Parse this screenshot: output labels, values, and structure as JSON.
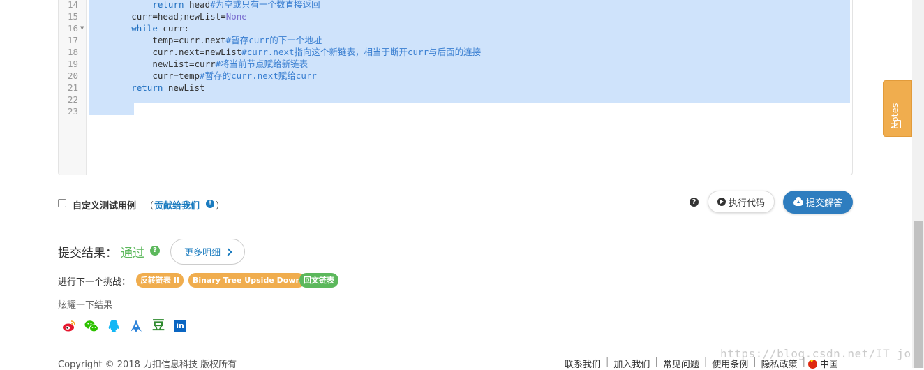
{
  "editor": {
    "lines": [
      {
        "no": "14",
        "fold": false
      },
      {
        "no": "15",
        "fold": false
      },
      {
        "no": "16",
        "fold": true
      },
      {
        "no": "17",
        "fold": false
      },
      {
        "no": "18",
        "fold": false
      },
      {
        "no": "19",
        "fold": false
      },
      {
        "no": "20",
        "fold": false
      },
      {
        "no": "21",
        "fold": false
      },
      {
        "no": "22",
        "fold": false
      },
      {
        "no": "23",
        "fold": false
      }
    ],
    "code": {
      "l14": {
        "indent": "            ",
        "kw": "return",
        "text": " head",
        "comment": "#为空或只有一个数直接返回"
      },
      "l15": {
        "indent": "        ",
        "text": "curr=head;newList=",
        "none": "None"
      },
      "l16": {
        "indent": "        ",
        "kw": "while",
        "text": " curr:"
      },
      "l17": {
        "indent": "            ",
        "text": "temp=curr.next",
        "comment": "#暂存curr的下一个地址"
      },
      "l18": {
        "indent": "            ",
        "text": "curr.next=newList",
        "comment": "#curr.next指向这个新链表，相当于断开curr与后面的连接"
      },
      "l19": {
        "indent": "            ",
        "text": "newList=curr",
        "comment": "#将当前节点赋给新链表"
      },
      "l20": {
        "indent": "            ",
        "text": "curr=temp",
        "comment": "#暂存的curr.next赋给curr"
      },
      "l21": {
        "indent": "        ",
        "kw": "return",
        "text": " newList"
      }
    }
  },
  "custom_test": {
    "label": "自定义测试用例",
    "open_paren": "（",
    "contribute": "贡献给我们",
    "close_paren": "）",
    "checked": false
  },
  "actions": {
    "help": "?",
    "run_label": "执行代码",
    "submit_label": "提交解答"
  },
  "result": {
    "label": "提交结果：",
    "status": "通过",
    "more_label": "更多明细"
  },
  "next_challenge": {
    "label": "进行下一个挑战：",
    "tags": [
      {
        "text": "反转链表 II",
        "color": "#f0ad4e"
      },
      {
        "text": "Binary Tree Upside Down",
        "color": "#f0ad4e"
      },
      {
        "text": "回文链表",
        "color": "#5cb85c"
      }
    ]
  },
  "share": {
    "label": "炫耀一下结果",
    "icons": [
      "weibo-icon",
      "wechat-icon",
      "qq-icon",
      "qzone-icon",
      "douban-icon",
      "linkedin-icon"
    ],
    "douban_char": "豆",
    "linkedin_text": "in"
  },
  "footer": {
    "copyright": "Copyright © 2018 力扣信息科技 版权所有",
    "links": [
      "联系我们",
      "加入我们",
      "常见问题",
      "使用条例",
      "隐私政策"
    ],
    "region": "中国"
  },
  "notes": {
    "label": "Notes"
  },
  "watermark": "https://blog.csdn.net/IT_job"
}
